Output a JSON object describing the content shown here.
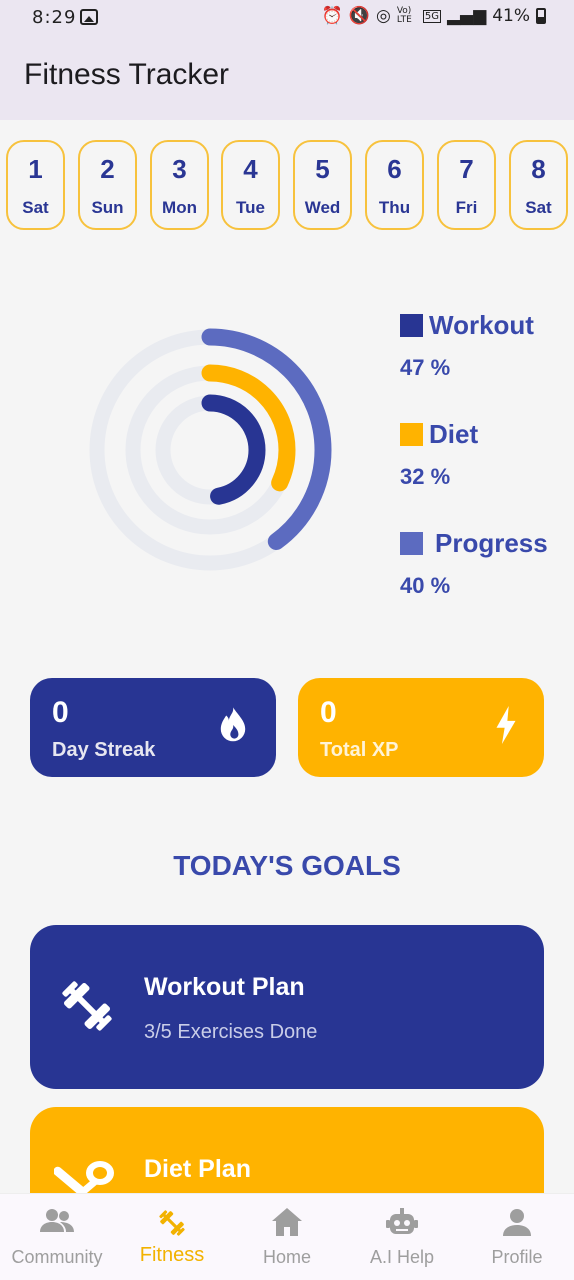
{
  "status_bar": {
    "time": "8:29",
    "network": "Vo) LTE",
    "signal_label": "5G",
    "battery": "41%"
  },
  "app_bar": {
    "title": "Fitness Tracker"
  },
  "days": [
    {
      "num": "1",
      "name": "Sat"
    },
    {
      "num": "2",
      "name": "Sun"
    },
    {
      "num": "3",
      "name": "Mon"
    },
    {
      "num": "4",
      "name": "Tue"
    },
    {
      "num": "5",
      "name": "Wed"
    },
    {
      "num": "6",
      "name": "Thu"
    },
    {
      "num": "7",
      "name": "Fri"
    },
    {
      "num": "8",
      "name": "Sat"
    }
  ],
  "rings": {
    "items": [
      {
        "label": "Workout",
        "pct": "47 %",
        "fraction": 0.47,
        "color": "#283593"
      },
      {
        "label": "Diet",
        "pct": "32 %",
        "fraction": 0.32,
        "color": "#ffb300"
      },
      {
        "label": "Progress",
        "pct": "40 %",
        "fraction": 0.4,
        "color": "#5c6bc0"
      }
    ],
    "track_color": "#e9ebf0"
  },
  "stats": {
    "streak": {
      "value": "0",
      "label": "Day Streak",
      "icon": "fire-icon"
    },
    "xp": {
      "value": "0",
      "label": "Total XP",
      "icon": "bolt-icon"
    }
  },
  "goals": {
    "title": "TODAY'S GOALS",
    "workout": {
      "title": "Workout Plan",
      "subtitle": "3/5 Exercises Done",
      "icon": "dumbbell-icon"
    },
    "diet": {
      "title": "Diet Plan",
      "icon": "utensils-icon"
    }
  },
  "nav": {
    "items": [
      {
        "label": "Community",
        "icon": "people-icon"
      },
      {
        "label": "Fitness",
        "icon": "dumbbell-icon",
        "active": true
      },
      {
        "label": "Home",
        "icon": "home-icon"
      },
      {
        "label": "A.I Help",
        "icon": "robot-icon"
      },
      {
        "label": "Profile",
        "icon": "person-icon"
      }
    ]
  },
  "colors": {
    "primary": "#283593",
    "accent": "#ffb300",
    "secondary": "#5c6bc0",
    "text_blue": "#3949ab"
  }
}
